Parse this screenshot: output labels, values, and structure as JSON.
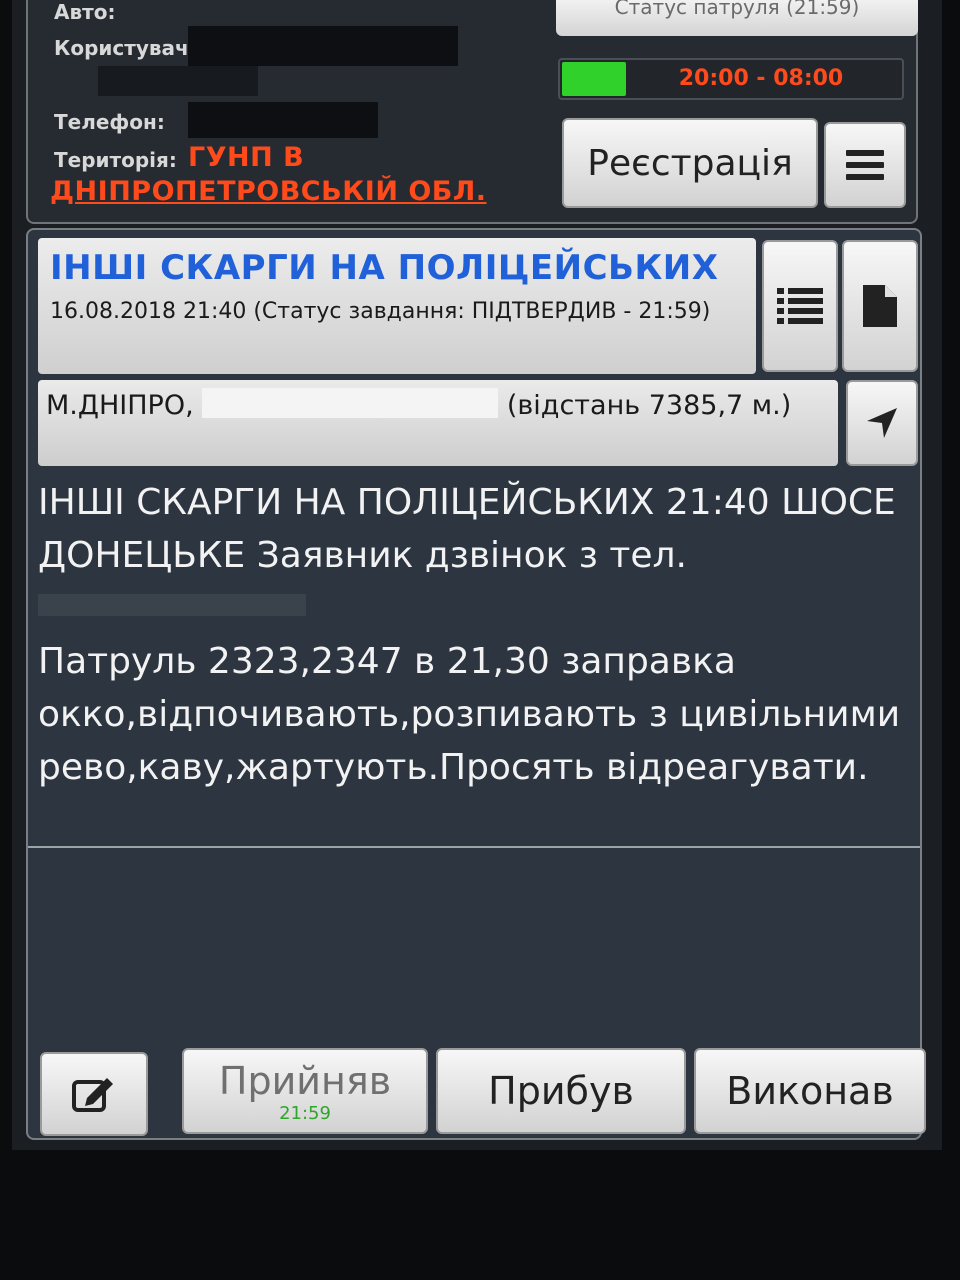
{
  "user_panel": {
    "auto_label": "Авто:",
    "user_label": "Користувач",
    "phone_label": "Телефон:",
    "territory_label": "Територія:",
    "territory_value_line1": "ГУНП В",
    "territory_value_line2": "ДНІПРОПЕТРОВСЬКІЙ ОБЛ."
  },
  "patrol": {
    "status_button_label": "Статус патруля (21:59)",
    "shift_time": "20:00 - 08:00",
    "shift_progress": 0.19,
    "register_button_label": "Реєстрація"
  },
  "task": {
    "title": "ІНШІ СКАРГИ НА ПОЛІЦЕЙСЬКИХ",
    "subtitle": "16.08.2018 21:40 (Статус завдання: ПІДТВЕРДИВ - 21:59)",
    "address_prefix": "М.ДНІПРО,",
    "address_distance": "(відстань 7385,7 м.)",
    "description_line1": "ІНШІ СКАРГИ НА ПОЛІЦЕЙСЬКИХ 21:40 ШОСЕ ДОНЕЦЬКЕ Заявник дзвінок з тел.",
    "description_line2": "Патруль 2323,2347 в 21,30 заправка окко,відпочивають,розпивають з цивільними рево,каву,жартують.Просять відреагувати."
  },
  "actions": {
    "accepted_label": "Прийняв",
    "accepted_time": "21:59",
    "arrived_label": "Прибув",
    "done_label": "Виконав"
  },
  "colors": {
    "accent_orange": "#ff4a1c",
    "title_blue": "#2060d8",
    "progress_green": "#2fd12a",
    "panel_bg": "#2c3540"
  }
}
